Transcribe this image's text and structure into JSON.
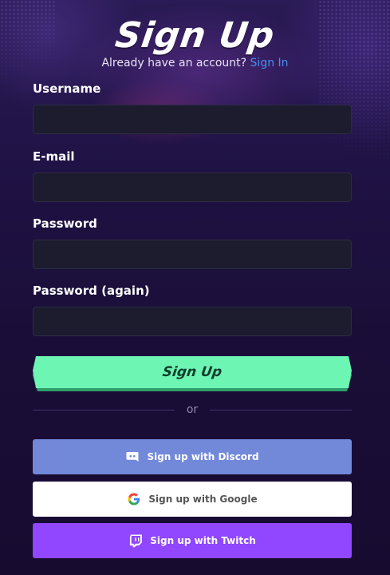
{
  "header": {
    "title": "Sign Up",
    "subtitle_text": "Already have an account?",
    "signin_link": "Sign In"
  },
  "form": {
    "fields": [
      {
        "label": "Username",
        "value": ""
      },
      {
        "label": "E-mail",
        "value": ""
      },
      {
        "label": "Password",
        "value": ""
      },
      {
        "label": "Password (again)",
        "value": ""
      }
    ],
    "submit_label": "Sign Up"
  },
  "divider_text": "or",
  "social": {
    "discord": {
      "label": "Sign up with Discord",
      "icon": "discord-icon",
      "color": "#7289da"
    },
    "google": {
      "label": "Sign up with Google",
      "icon": "google-icon",
      "color": "#ffffff"
    },
    "twitch": {
      "label": "Sign up with Twitch",
      "icon": "twitch-icon",
      "color": "#9146ff"
    }
  },
  "colors": {
    "accent_green": "#6df5b4",
    "link_blue": "#4b8ef0",
    "input_bg": "#1c1c2e"
  }
}
